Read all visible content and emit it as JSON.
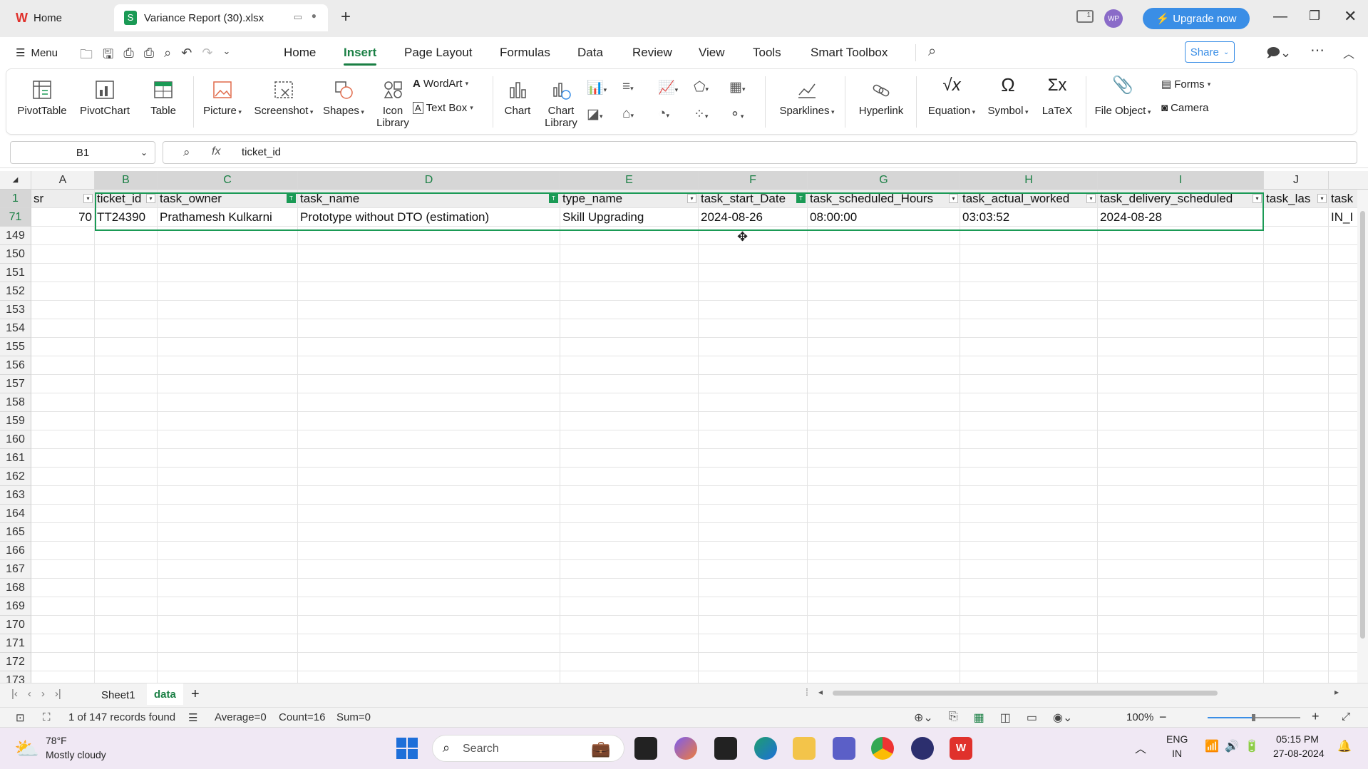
{
  "tabs": [
    {
      "label": "Home",
      "active": false
    },
    {
      "label": "Variance Report (30).xlsx",
      "active": true
    }
  ],
  "titlebar": {
    "upgrade": "Upgrade now",
    "avatar": "WP",
    "badge": "1"
  },
  "menu": {
    "menu_label": "Menu",
    "items": [
      "Home",
      "Insert",
      "Page Layout",
      "Formulas",
      "Data",
      "Review",
      "View",
      "Tools",
      "Smart Toolbox"
    ],
    "active": "Insert",
    "share": "Share"
  },
  "ribbon": {
    "big": [
      {
        "label": "PivotTable",
        "icon": "pivottable-icon"
      },
      {
        "label": "PivotChart",
        "icon": "pivotchart-icon"
      },
      {
        "label": "Table",
        "icon": "table-icon"
      },
      {
        "label": "Picture",
        "icon": "picture-icon"
      },
      {
        "label": "Screenshot",
        "icon": "screenshot-icon"
      },
      {
        "label": "Shapes",
        "icon": "shapes-icon"
      },
      {
        "label": "Icon Library",
        "icon": "icon-library-icon"
      },
      {
        "label": "Chart",
        "icon": "chart-icon"
      },
      {
        "label": "Chart Library",
        "icon": "chart-library-icon"
      },
      {
        "label": "Sparklines",
        "icon": "sparklines-icon"
      },
      {
        "label": "Hyperlink",
        "icon": "hyperlink-icon"
      },
      {
        "label": "Equation",
        "icon": "equation-icon"
      },
      {
        "label": "Symbol",
        "icon": "symbol-icon"
      },
      {
        "label": "LaTeX",
        "icon": "latex-icon"
      },
      {
        "label": "File Object",
        "icon": "file-object-icon"
      }
    ],
    "wordart": "WordArt",
    "textbox": "Text Box",
    "forms": "Forms",
    "camera": "Camera"
  },
  "formula_bar": {
    "name_box": "B1",
    "fx": "fx",
    "content": "ticket_id"
  },
  "columns": [
    {
      "letter": "A",
      "header": "sr",
      "filter": "none"
    },
    {
      "letter": "B",
      "header": "ticket_id",
      "filter": "none"
    },
    {
      "letter": "C",
      "header": "task_owner",
      "filter": "active"
    },
    {
      "letter": "D",
      "header": "task_name",
      "filter": "active"
    },
    {
      "letter": "E",
      "header": "type_name",
      "filter": "none"
    },
    {
      "letter": "F",
      "header": "task_start_Date",
      "filter": "active"
    },
    {
      "letter": "G",
      "header": "task_scheduled_Hours",
      "filter": "none"
    },
    {
      "letter": "H",
      "header": "task_actual_worked",
      "filter": "none"
    },
    {
      "letter": "I",
      "header": "task_delivery_scheduled",
      "filter": "none"
    },
    {
      "letter": "J",
      "header": "task_las",
      "filter": "none"
    },
    {
      "letter": "",
      "header": "task",
      "filter": "none"
    }
  ],
  "rows": [
    {
      "num": "71",
      "cells": [
        "70",
        "TT24390",
        "Prathamesh Kulkarni",
        "Prototype without DTO (estimation)",
        "Skill Upgrading",
        "2024-08-26",
        "08:00:00",
        "03:03:52",
        "2024-08-28",
        "",
        "IN_I"
      ]
    }
  ],
  "empty_rows": [
    "149",
    "150",
    "151",
    "152",
    "153",
    "154",
    "155",
    "156",
    "157",
    "158",
    "159",
    "160",
    "161",
    "162",
    "163",
    "164",
    "165",
    "166",
    "167",
    "168",
    "169",
    "170",
    "171",
    "172",
    "173"
  ],
  "sheets": [
    "Sheet1",
    "data"
  ],
  "active_sheet": "data",
  "status": {
    "records": "1 of 147 records found",
    "average": "Average=0",
    "count": "Count=16",
    "sum": "Sum=0",
    "zoom": "100%"
  },
  "taskbar": {
    "temp": "78°F",
    "weather": "Mostly cloudy",
    "search": "Search",
    "lang1": "ENG",
    "lang2": "IN",
    "time": "05:15 PM",
    "date": "27-08-2024"
  },
  "colors": {
    "accent": "#1a7f44",
    "upgrade": "#3a8ee6",
    "filter_on": "#1a9a55"
  }
}
